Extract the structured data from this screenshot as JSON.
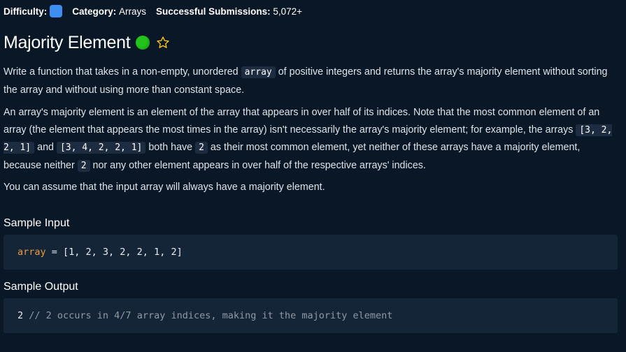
{
  "meta": {
    "difficulty_label": "Difficulty:",
    "category_label": "Category:",
    "category_value": "Arrays",
    "submissions_label": "Successful Submissions:",
    "submissions_value": "5,072+",
    "difficulty_color": "#3d8ef0"
  },
  "title": "Majority Element",
  "status_color": "#22c41b",
  "p1": {
    "a": "Write a function that takes in a non-empty, unordered ",
    "code1": "array",
    "b": " of positive integers and returns the array's majority element without sorting the array and without using more than constant space."
  },
  "p2": {
    "a": "An array's majority element is an element of the array that appears in over half of its indices. Note that the most common element of an array (the element that appears the most times in the array) isn't necessarily the array's majority element; for example, the arrays ",
    "code1": "[3, 2, 2, 1]",
    "b": " and ",
    "code2": "[3, 4, 2, 2, 1]",
    "c": " both have ",
    "code3": "2",
    "d": " as their most common element, yet neither of these arrays have a majority element, because neither ",
    "code4": "2",
    "e": " nor any other element appears in over half of the respective arrays' indices."
  },
  "p3": "You can assume that the input array will always have a majority element.",
  "sample_input": {
    "heading": "Sample Input",
    "var_name": "array",
    "rest": " = [1, 2, 3, 2, 2, 1, 2]"
  },
  "sample_output": {
    "heading": "Sample Output",
    "value": "2 ",
    "comment": "// 2 occurs in 4/7 array indices, making it the majority element"
  }
}
